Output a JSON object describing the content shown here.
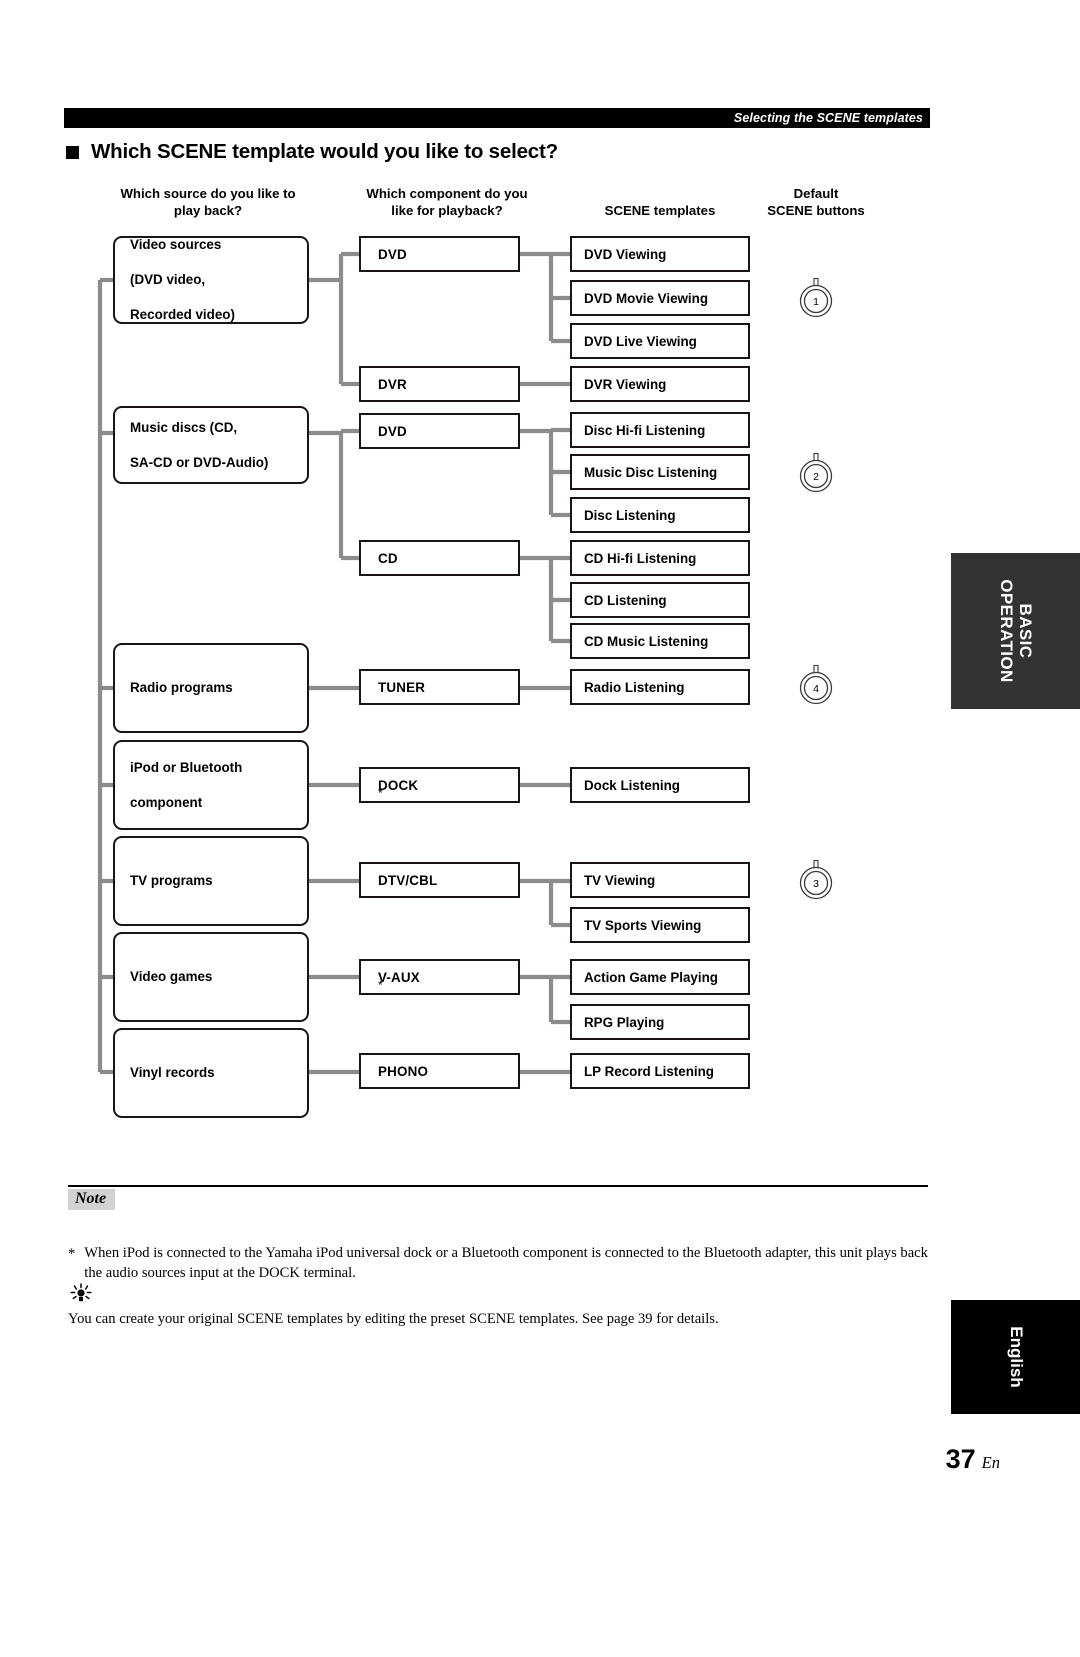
{
  "header": {
    "running_title": "Selecting the SCENE templates"
  },
  "section": {
    "title": "Which SCENE template would you like to select?"
  },
  "columns": {
    "source": "Which source do you like to\nplay back?",
    "source_l1": "Which source do you like to",
    "source_l2": "play back?",
    "component_l1": "Which component do you",
    "component_l2": "like for playback?",
    "templates": "SCENE templates",
    "buttons_l1": "Default",
    "buttons_l2": "SCENE buttons"
  },
  "flow": {
    "sources": [
      {
        "id": "video-sources",
        "lines": [
          "Video sources",
          "(DVD video,",
          "Recorded video)"
        ]
      },
      {
        "id": "music-discs",
        "lines": [
          "Music discs (CD,",
          "SA-CD or DVD-Audio)"
        ]
      },
      {
        "id": "radio-programs",
        "lines": [
          "Radio programs"
        ]
      },
      {
        "id": "ipod-bluetooth",
        "lines": [
          "iPod or Bluetooth",
          "component"
        ]
      },
      {
        "id": "tv-programs",
        "lines": [
          "TV programs"
        ]
      },
      {
        "id": "video-games",
        "lines": [
          "Video games"
        ]
      },
      {
        "id": "vinyl-records",
        "lines": [
          "Vinyl records"
        ]
      }
    ],
    "components": [
      {
        "id": "dvd-1",
        "label": "DVD",
        "footnote": ""
      },
      {
        "id": "dvr",
        "label": "DVR",
        "footnote": ""
      },
      {
        "id": "dvd-2",
        "label": "DVD",
        "footnote": ""
      },
      {
        "id": "cd",
        "label": "CD",
        "footnote": ""
      },
      {
        "id": "tuner",
        "label": "TUNER",
        "footnote": ""
      },
      {
        "id": "dock",
        "label": "DOCK",
        "footnote": "*"
      },
      {
        "id": "dtv-cbl",
        "label": "DTV/CBL",
        "footnote": ""
      },
      {
        "id": "v-aux",
        "label": "V-AUX",
        "footnote": "*"
      },
      {
        "id": "phono",
        "label": "PHONO",
        "footnote": ""
      }
    ],
    "templates": [
      {
        "id": "dvd-viewing",
        "label": "DVD Viewing"
      },
      {
        "id": "dvd-movie-viewing",
        "label": "DVD Movie Viewing"
      },
      {
        "id": "dvd-live-viewing",
        "label": "DVD Live Viewing"
      },
      {
        "id": "dvr-viewing",
        "label": "DVR Viewing"
      },
      {
        "id": "disc-hifi-listening",
        "label": "Disc Hi-fi Listening"
      },
      {
        "id": "music-disc-listening",
        "label": "Music Disc Listening"
      },
      {
        "id": "disc-listening",
        "label": "Disc Listening"
      },
      {
        "id": "cd-hifi-listening",
        "label": "CD Hi-fi Listening"
      },
      {
        "id": "cd-listening",
        "label": "CD Listening"
      },
      {
        "id": "cd-music-listening",
        "label": "CD Music Listening"
      },
      {
        "id": "radio-listening",
        "label": "Radio Listening"
      },
      {
        "id": "dock-listening",
        "label": "Dock Listening"
      },
      {
        "id": "tv-viewing",
        "label": "TV Viewing"
      },
      {
        "id": "tv-sports-viewing",
        "label": "TV Sports Viewing"
      },
      {
        "id": "action-game-playing",
        "label": "Action Game Playing"
      },
      {
        "id": "rpg-playing",
        "label": "RPG Playing"
      },
      {
        "id": "lp-record-listening",
        "label": "LP Record Listening"
      }
    ],
    "scene_buttons": [
      {
        "id": "scene-1",
        "number": "1",
        "aligned_template": "dvd-movie-viewing"
      },
      {
        "id": "scene-2",
        "number": "2",
        "aligned_template": "music-disc-listening"
      },
      {
        "id": "scene-4",
        "number": "4",
        "aligned_template": "radio-listening"
      },
      {
        "id": "scene-3",
        "number": "3",
        "aligned_template": "tv-viewing"
      }
    ],
    "connector_color": "#8c8c8c"
  },
  "note": {
    "badge": "Note",
    "footnote_marker": "*",
    "footnote_text": "When iPod is connected to the Yamaha iPod universal dock or a Bluetooth component is connected to the Bluetooth adapter, this unit plays back the audio sources input at the DOCK terminal."
  },
  "tip": {
    "icon": "lightbulb-icon",
    "text": "You can create your original SCENE templates by editing the preset SCENE templates. See page 39 for details."
  },
  "side_tabs": {
    "basic_l1": "BASIC",
    "basic_l2": "OPERATION",
    "language": "English"
  },
  "footer": {
    "page_number": "37",
    "page_suffix": "En"
  }
}
